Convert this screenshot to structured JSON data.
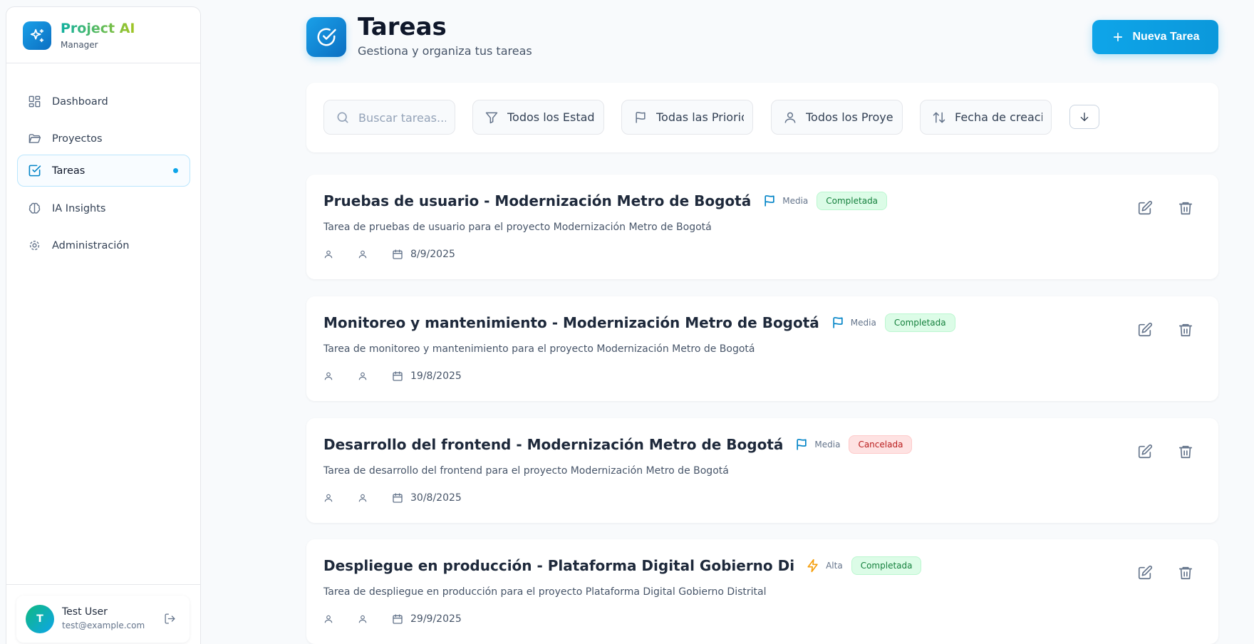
{
  "app": {
    "name": "Project AI",
    "subtitle": "Manager"
  },
  "colors": {
    "accent": "#0ea5e9",
    "brand_gradient_start": "#10b0a0",
    "brand_gradient_end": "#a2c523",
    "completed": "#15803d",
    "cancelled": "#b91c1c",
    "high_priority": "#f59e0b"
  },
  "sidebar": {
    "items": [
      {
        "label": "Dashboard",
        "icon": "dashboard-grid-icon",
        "active": false
      },
      {
        "label": "Proyectos",
        "icon": "folder-icon",
        "active": false
      },
      {
        "label": "Tareas",
        "icon": "checkbox-icon",
        "active": true
      },
      {
        "label": "IA Insights",
        "icon": "brain-icon",
        "active": false
      },
      {
        "label": "Administración",
        "icon": "gear-icon",
        "active": false
      }
    ]
  },
  "user": {
    "initial": "T",
    "name": "Test User",
    "email": "test@example.com"
  },
  "header": {
    "title": "Tareas",
    "subtitle": "Gestiona y organiza tus tareas",
    "new_button": "Nueva Tarea"
  },
  "filters": {
    "search_placeholder": "Buscar tareas...",
    "status": "Todos los Estados",
    "priority": "Todas las Prioridades",
    "project": "Todos los Proyectos",
    "sort_by": "Fecha de creación",
    "sort_direction_icon": "arrow-down-icon"
  },
  "tasks": [
    {
      "title": "Pruebas de usuario - Modernización Metro de Bogotá",
      "priority": "Media",
      "priority_icon": "flag-icon",
      "status": "Completada",
      "description": "Tarea de pruebas de usuario para el proyecto Modernización Metro de Bogotá",
      "date": "8/9/2025"
    },
    {
      "title": "Monitoreo y mantenimiento - Modernización Metro de Bogotá",
      "priority": "Media",
      "priority_icon": "flag-icon",
      "status": "Completada",
      "description": "Tarea de monitoreo y mantenimiento para el proyecto Modernización Metro de Bogotá",
      "date": "19/8/2025"
    },
    {
      "title": "Desarrollo del frontend - Modernización Metro de Bogotá",
      "priority": "Media",
      "priority_icon": "flag-icon",
      "status": "Cancelada",
      "description": "Tarea de desarrollo del frontend para el proyecto Modernización Metro de Bogotá",
      "date": "30/8/2025"
    },
    {
      "title": "Despliegue en producción - Plataforma Digital Gobierno Di",
      "priority": "Alta",
      "priority_icon": "lightning-icon",
      "status": "Completada",
      "description": "Tarea de despliegue en producción para el proyecto Plataforma Digital Gobierno Distrital",
      "date": "29/9/2025"
    }
  ]
}
